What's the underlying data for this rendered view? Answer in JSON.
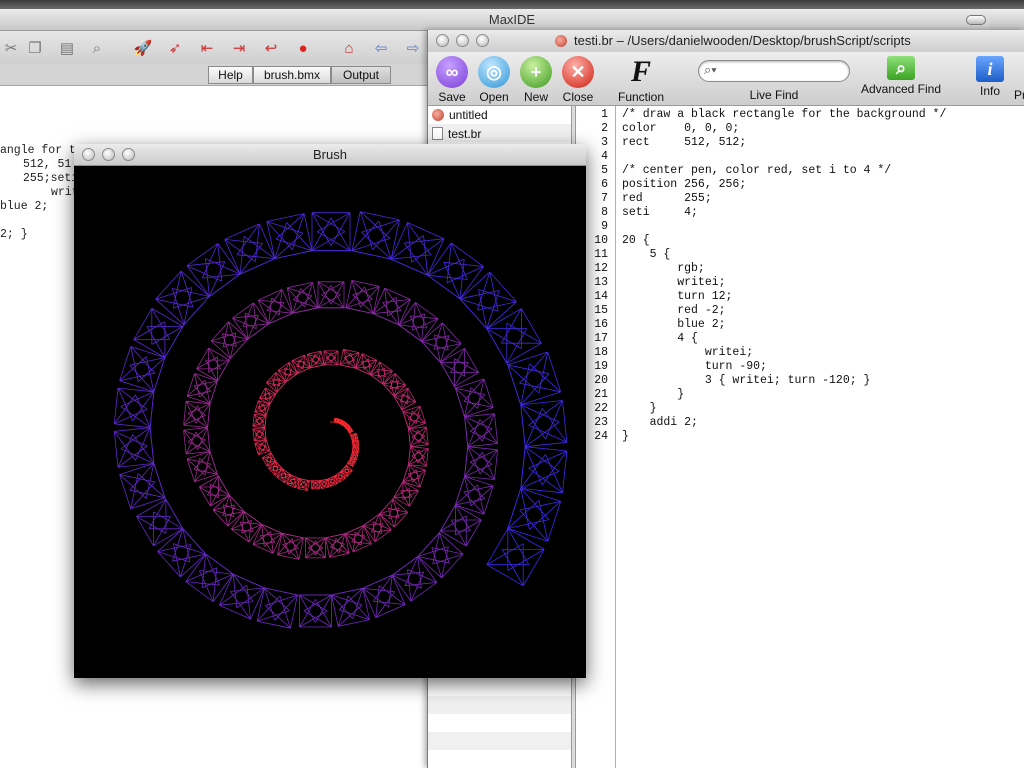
{
  "maxide": {
    "title": "MaxIDE",
    "tabs": [
      "Help",
      "brush.bmx",
      "Output"
    ],
    "code_fragments": [
      "angle for th",
      "512, 51",
      "255;seti",
      "writ",
      "blue 2;",
      "2; }"
    ]
  },
  "editor": {
    "title": "testi.br – /Users/danielwooden/Desktop/brushScript/scripts",
    "toolbar": {
      "save": "Save",
      "open": "Open",
      "new": "New",
      "close": "Close",
      "function": "Function",
      "function_glyph": "F",
      "live_find": "Live Find",
      "advanced_find": "Advanced Find",
      "info": "Info",
      "info_glyph": "i",
      "overflow": "Pr",
      "search_value": ""
    },
    "files": [
      "untitled",
      "test.br"
    ],
    "code_lines": [
      "/* draw a black rectangle for the background */",
      "color    0, 0, 0;",
      "rect     512, 512;",
      "",
      "/* center pen, color red, set i to 4 */",
      "position 256, 256;",
      "red      255;",
      "seti     4;",
      "",
      "20 {",
      "    5 {",
      "        rgb;",
      "        writei;",
      "        turn 12;",
      "        red -2;",
      "        blue 2;",
      "        4 {",
      "            writei;",
      "            turn -90;",
      "            3 { writei; turn -120; }",
      "        }",
      "    }",
      "    addi 2;",
      "}"
    ]
  },
  "brush": {
    "title": "Brush",
    "background": "#000000",
    "start_color": "#ff3b1e",
    "end_color": "#4a3cff"
  },
  "colors": {
    "accent_red": "#d3281a",
    "window_chrome": "#d2d2d2"
  }
}
